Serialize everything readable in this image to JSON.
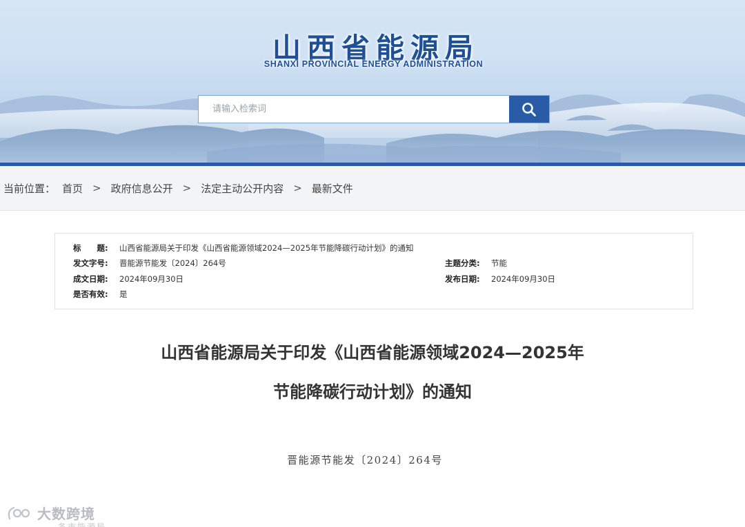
{
  "header": {
    "logo_cn": "山西省能源局",
    "logo_en": "SHANXI  PROVINCIAL  ENERGY ADMINISTRATION",
    "search_placeholder": "请输入检索词",
    "search_icon": "search-icon"
  },
  "breadcrumb": {
    "prefix": "当前位置：",
    "items": [
      "首页",
      "政府信息公开",
      "法定主动公开内容",
      "最新文件"
    ],
    "separator": ">"
  },
  "info": {
    "title_label": "标　　题:",
    "title_value": "山西省能源局关于印发《山西省能源领域2024—2025年节能降碳行动计划》的通知",
    "doc_no_label": "发文字号:",
    "doc_no_value": "晋能源节能发〔2024〕264号",
    "category_label": "主题分类:",
    "category_value": "节能",
    "created_label": "成文日期:",
    "created_value": "2024年09月30日",
    "published_label": "发布日期:",
    "published_value": "2024年09月30日",
    "valid_label": "是否有效:",
    "valid_value": "是"
  },
  "document": {
    "title_line1": "山西省能源局关于印发《山西省能源领域2024—2025年",
    "title_line2": "节能降碳行动计划》的通知",
    "doc_number": "晋能源节能发〔2024〕264号"
  },
  "watermark": {
    "text": "大数跨境",
    "subtext": "各市能源局"
  },
  "colors": {
    "brand_blue": "#2a5ba6",
    "logo_blue": "#1f4f95",
    "breadcrumb_bg": "#f3f4f6"
  }
}
